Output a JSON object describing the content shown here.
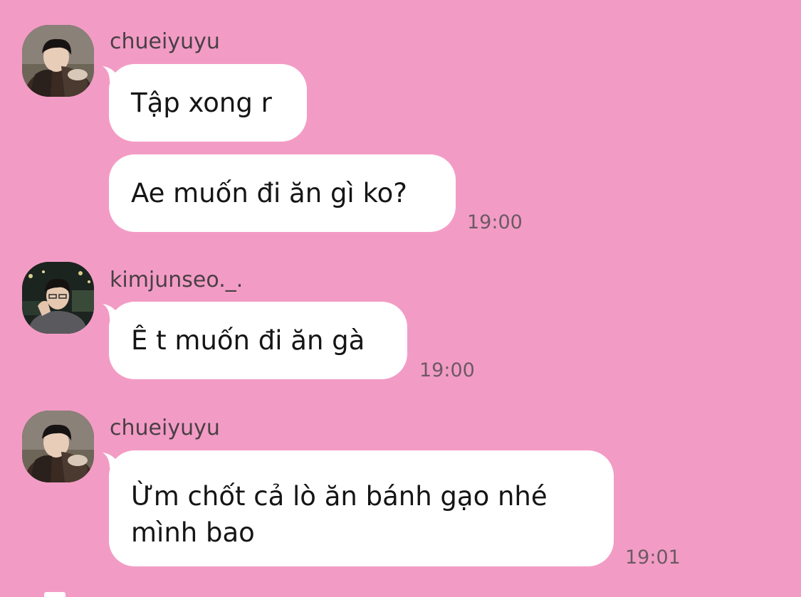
{
  "theme": {
    "background": "#f29cc5",
    "bubble": "#ffffff",
    "text": "#151515",
    "meta": "#6d5964"
  },
  "messages": [
    {
      "sender": "chueiyuyu",
      "avatar": "user-avatar-chueiyuyu",
      "bubbles": [
        "Tập xong r",
        "Ae muốn đi ăn gì ko?"
      ],
      "time": "19:00"
    },
    {
      "sender": "kimjunseo._.",
      "avatar": "user-avatar-kimjunseo",
      "bubbles": [
        "Ê t muốn đi ăn gà"
      ],
      "time": "19:00"
    },
    {
      "sender": "chueiyuyu",
      "avatar": "user-avatar-chueiyuyu",
      "bubbles": [
        "Ừm chốt cả lò ăn bánh gạo nhé mình bao"
      ],
      "time": "19:01"
    }
  ]
}
